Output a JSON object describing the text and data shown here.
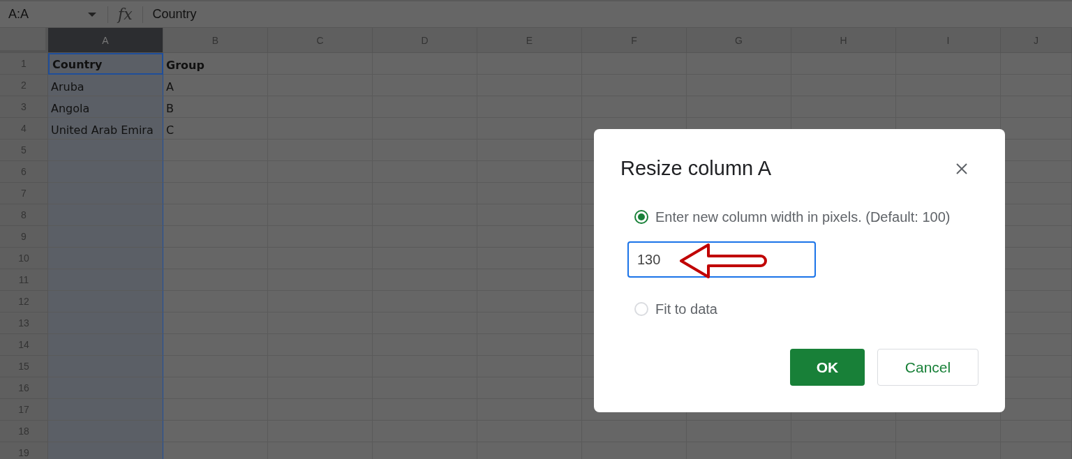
{
  "formula_bar": {
    "name_box": "A:A",
    "fx": "fx",
    "content": "Country"
  },
  "sheet": {
    "columns": [
      {
        "label": "A",
        "selected": true
      },
      {
        "label": "B",
        "selected": false
      },
      {
        "label": "C",
        "selected": false
      },
      {
        "label": "D",
        "selected": false
      },
      {
        "label": "E",
        "selected": false
      },
      {
        "label": "F",
        "selected": false
      },
      {
        "label": "G",
        "selected": false
      },
      {
        "label": "H",
        "selected": false
      },
      {
        "label": "I",
        "selected": false
      },
      {
        "label": "J",
        "selected": false
      }
    ],
    "rows": [
      {
        "number": "1",
        "bold": true,
        "cells": [
          "Country",
          "Group"
        ]
      },
      {
        "number": "2",
        "bold": false,
        "cells": [
          "Aruba",
          "A"
        ]
      },
      {
        "number": "3",
        "bold": false,
        "cells": [
          "Angola",
          "B"
        ]
      },
      {
        "number": "4",
        "bold": false,
        "cells": [
          "United Arab Emira",
          "C"
        ]
      },
      {
        "number": "5"
      },
      {
        "number": "6"
      },
      {
        "number": "7"
      },
      {
        "number": "8"
      },
      {
        "number": "9"
      },
      {
        "number": "10"
      },
      {
        "number": "11"
      },
      {
        "number": "12"
      },
      {
        "number": "13"
      },
      {
        "number": "14"
      },
      {
        "number": "15"
      },
      {
        "number": "16"
      },
      {
        "number": "17"
      },
      {
        "number": "18"
      },
      {
        "number": "19"
      }
    ]
  },
  "dialog": {
    "title": "Resize column A",
    "options": [
      {
        "label": "Enter new column width in pixels. (Default: 100)",
        "selected": true
      },
      {
        "label": "Fit to data",
        "selected": false
      }
    ],
    "width_value": "130",
    "buttons": [
      {
        "label": "OK",
        "kind": "primary"
      },
      {
        "label": "Cancel",
        "kind": "secondary"
      }
    ]
  }
}
